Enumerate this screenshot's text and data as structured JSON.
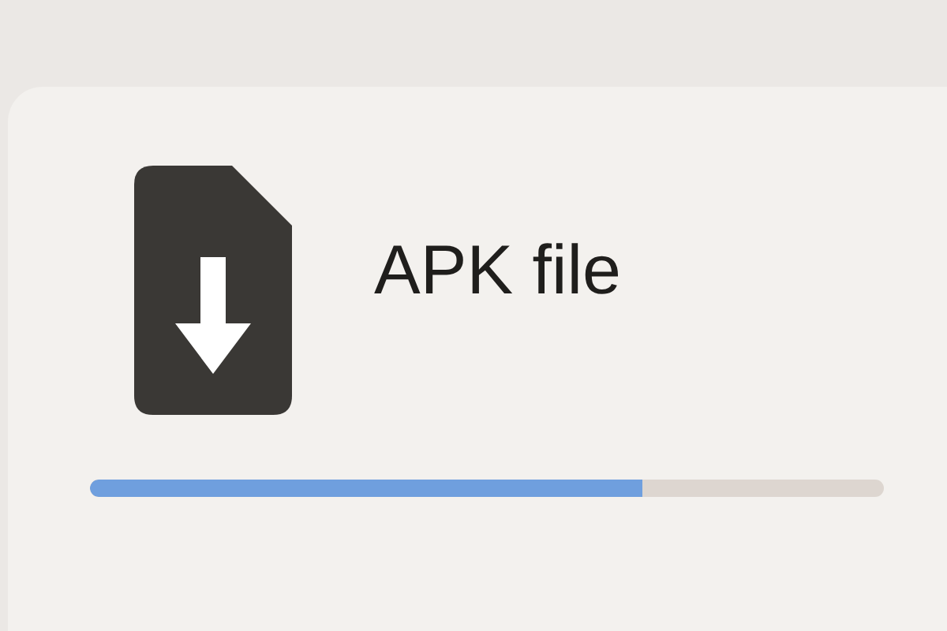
{
  "file": {
    "name": "APK file"
  },
  "download": {
    "level": 0.696
  }
}
